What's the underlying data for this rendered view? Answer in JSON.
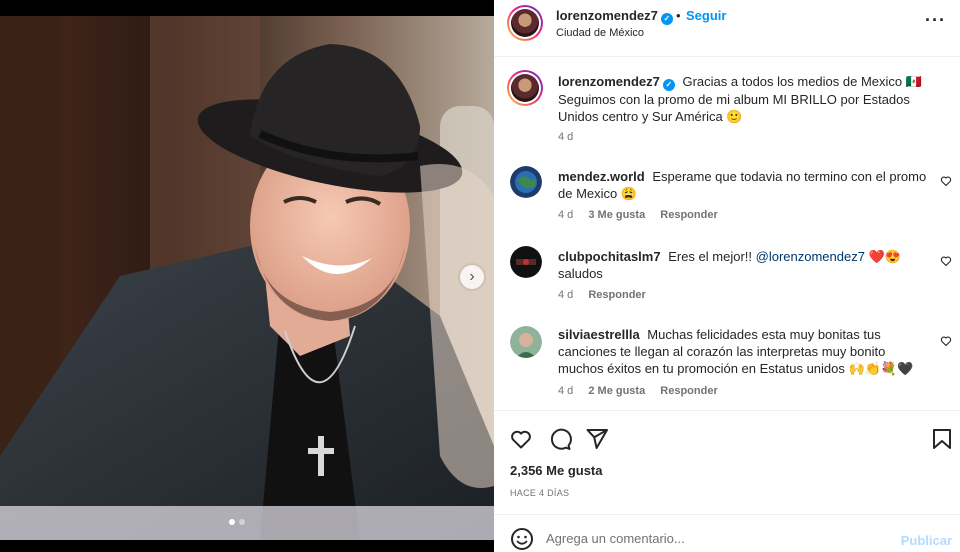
{
  "post": {
    "username": "lorenzomendez7",
    "verified_mark": "✓",
    "separator": "•",
    "follow_label": "Seguir",
    "location": "Ciudad de México",
    "more_label": "···"
  },
  "caption": {
    "username": "lorenzomendez7",
    "text": "Gracias a todos los medios de Mexico 🇲🇽 Seguimos con la promo de mi album MI BRILLO por Estados Unidos centro y Sur América 🙂",
    "time": "4 d"
  },
  "comments": [
    {
      "username": "mendez.world",
      "text": "Esperame que todavia no termino con el promo de Mexico 😩",
      "time": "4 d",
      "likes": "3 Me gusta",
      "reply": "Responder"
    },
    {
      "username": "clubpochitaslm7",
      "text_before": "Eres el mejor!! ",
      "mention": "@lorenzomendez7",
      "text_after": " ❤️😍 saludos",
      "time": "4 d",
      "reply": "Responder"
    },
    {
      "username": "silviaestrellla",
      "text": "Muchas felicidades esta muy bonitas tus canciones te llegan al corazón las interpretas muy bonito muchos éxitos en tu promoción en Estatus unidos 🙌👏💐🖤",
      "time": "4 d",
      "likes": "2 Me gusta",
      "reply": "Responder"
    }
  ],
  "icons": {
    "like": "heart-icon",
    "comment": "comment-icon",
    "share": "share-icon",
    "save": "bookmark-icon",
    "emoji": "emoji-icon",
    "next": "chevron-right-icon"
  },
  "stats": {
    "likes": "2,356 Me gusta",
    "time_ago": "HACE 4 DÍAS"
  },
  "composer": {
    "placeholder": "Agrega un comentario...",
    "publish_label": "Publicar"
  },
  "carousel": {
    "next_glyph": "›",
    "slides": 2,
    "current": 1
  },
  "colors": {
    "accent": "#0095f6",
    "publish_disabled": "#b3dbff",
    "muted": "#737373",
    "like_heart": "#ed4956"
  }
}
